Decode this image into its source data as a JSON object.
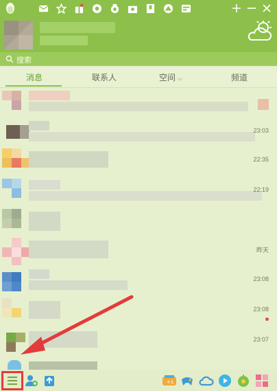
{
  "search": {
    "placeholder": "搜索"
  },
  "tabs": [
    {
      "label": "消息",
      "active": true
    },
    {
      "label": "联系人"
    },
    {
      "label": "空间"
    },
    {
      "label": "频道",
      "badge": true
    }
  ],
  "conversations": [
    {
      "time": ""
    },
    {
      "time": "23:03"
    },
    {
      "time": "22:35"
    },
    {
      "time": "22:19"
    },
    {
      "time": ""
    },
    {
      "time": "昨天"
    },
    {
      "time": "23:08"
    },
    {
      "time": "23:08",
      "unread": true
    },
    {
      "time": "23:07"
    },
    {
      "time": ""
    }
  ],
  "colors": {
    "accent": "#8cc04a",
    "highlight": "#e33b3b"
  },
  "icons": {
    "titlebar": [
      "mail-icon",
      "star-icon",
      "gift-icon",
      "music-icon",
      "bag-icon",
      "shop-icon",
      "book-icon",
      "browser-icon",
      "mini-app-icon",
      "add-icon",
      "minimize-icon",
      "close-icon"
    ],
    "bottombar": [
      "main-menu-icon",
      "add-contact-icon",
      "file-transfer-icon",
      "game-icon",
      "controller-icon",
      "weiyun-icon",
      "video-icon",
      "lucky-icon",
      "app-manager-icon"
    ]
  }
}
